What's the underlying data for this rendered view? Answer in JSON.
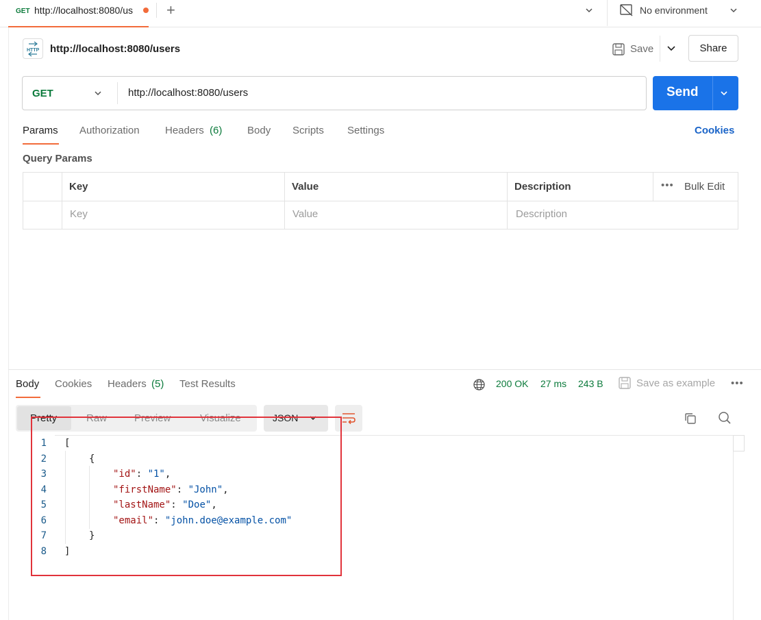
{
  "tabbar": {
    "active_tab": {
      "method": "GET",
      "title": "http://localhost:8080/us"
    },
    "new_tab_symbol": "+",
    "environment": "No environment"
  },
  "request": {
    "title": "http://localhost:8080/users",
    "save_label": "Save",
    "share_label": "Share",
    "method": "GET",
    "url": "http://localhost:8080/users",
    "send_label": "Send",
    "tabs": {
      "params": "Params",
      "authorization": "Authorization",
      "headers": "Headers",
      "headers_count": "(6)",
      "body": "Body",
      "scripts": "Scripts",
      "settings": "Settings"
    },
    "cookies_link": "Cookies",
    "query_params": {
      "title": "Query Params",
      "columns": [
        "Key",
        "Value",
        "Description"
      ],
      "placeholders": [
        "Key",
        "Value",
        "Description"
      ],
      "more_symbol": "•••",
      "bulk_edit": "Bulk Edit"
    }
  },
  "response": {
    "tabs": {
      "body": "Body",
      "cookies": "Cookies",
      "headers": "Headers",
      "headers_count": "(5)",
      "test_results": "Test Results"
    },
    "status": "200 OK",
    "time": "27 ms",
    "size": "243 B",
    "save_as_example": "Save as example",
    "more_symbol": "•••",
    "view_modes": [
      "Pretty",
      "Raw",
      "Preview",
      "Visualize"
    ],
    "format": "JSON",
    "line_numbers": [
      "1",
      "2",
      "3",
      "4",
      "5",
      "6",
      "7",
      "8"
    ],
    "json": {
      "open_bracket": "[",
      "open_brace": "{",
      "fields": [
        {
          "key": "\"id\"",
          "value": "\"1\"",
          "sep": ": ",
          "trail": ","
        },
        {
          "key": "\"firstName\"",
          "value": "\"John\"",
          "sep": ": ",
          "trail": ","
        },
        {
          "key": "\"lastName\"",
          "value": "\"Doe\"",
          "sep": ": ",
          "trail": ","
        },
        {
          "key": "\"email\"",
          "value": "\"john.doe@example.com\"",
          "sep": ": ",
          "trail": ""
        }
      ],
      "close_brace": "}",
      "close_bracket": "]"
    }
  },
  "colors": {
    "accent": "#f26b3a",
    "send": "#1a73e8",
    "method_get": "#0b7a3b",
    "status_ok": "#0b7a3b",
    "json_key": "#a31515",
    "json_string": "#0451a5",
    "highlight": "#e1323a"
  }
}
